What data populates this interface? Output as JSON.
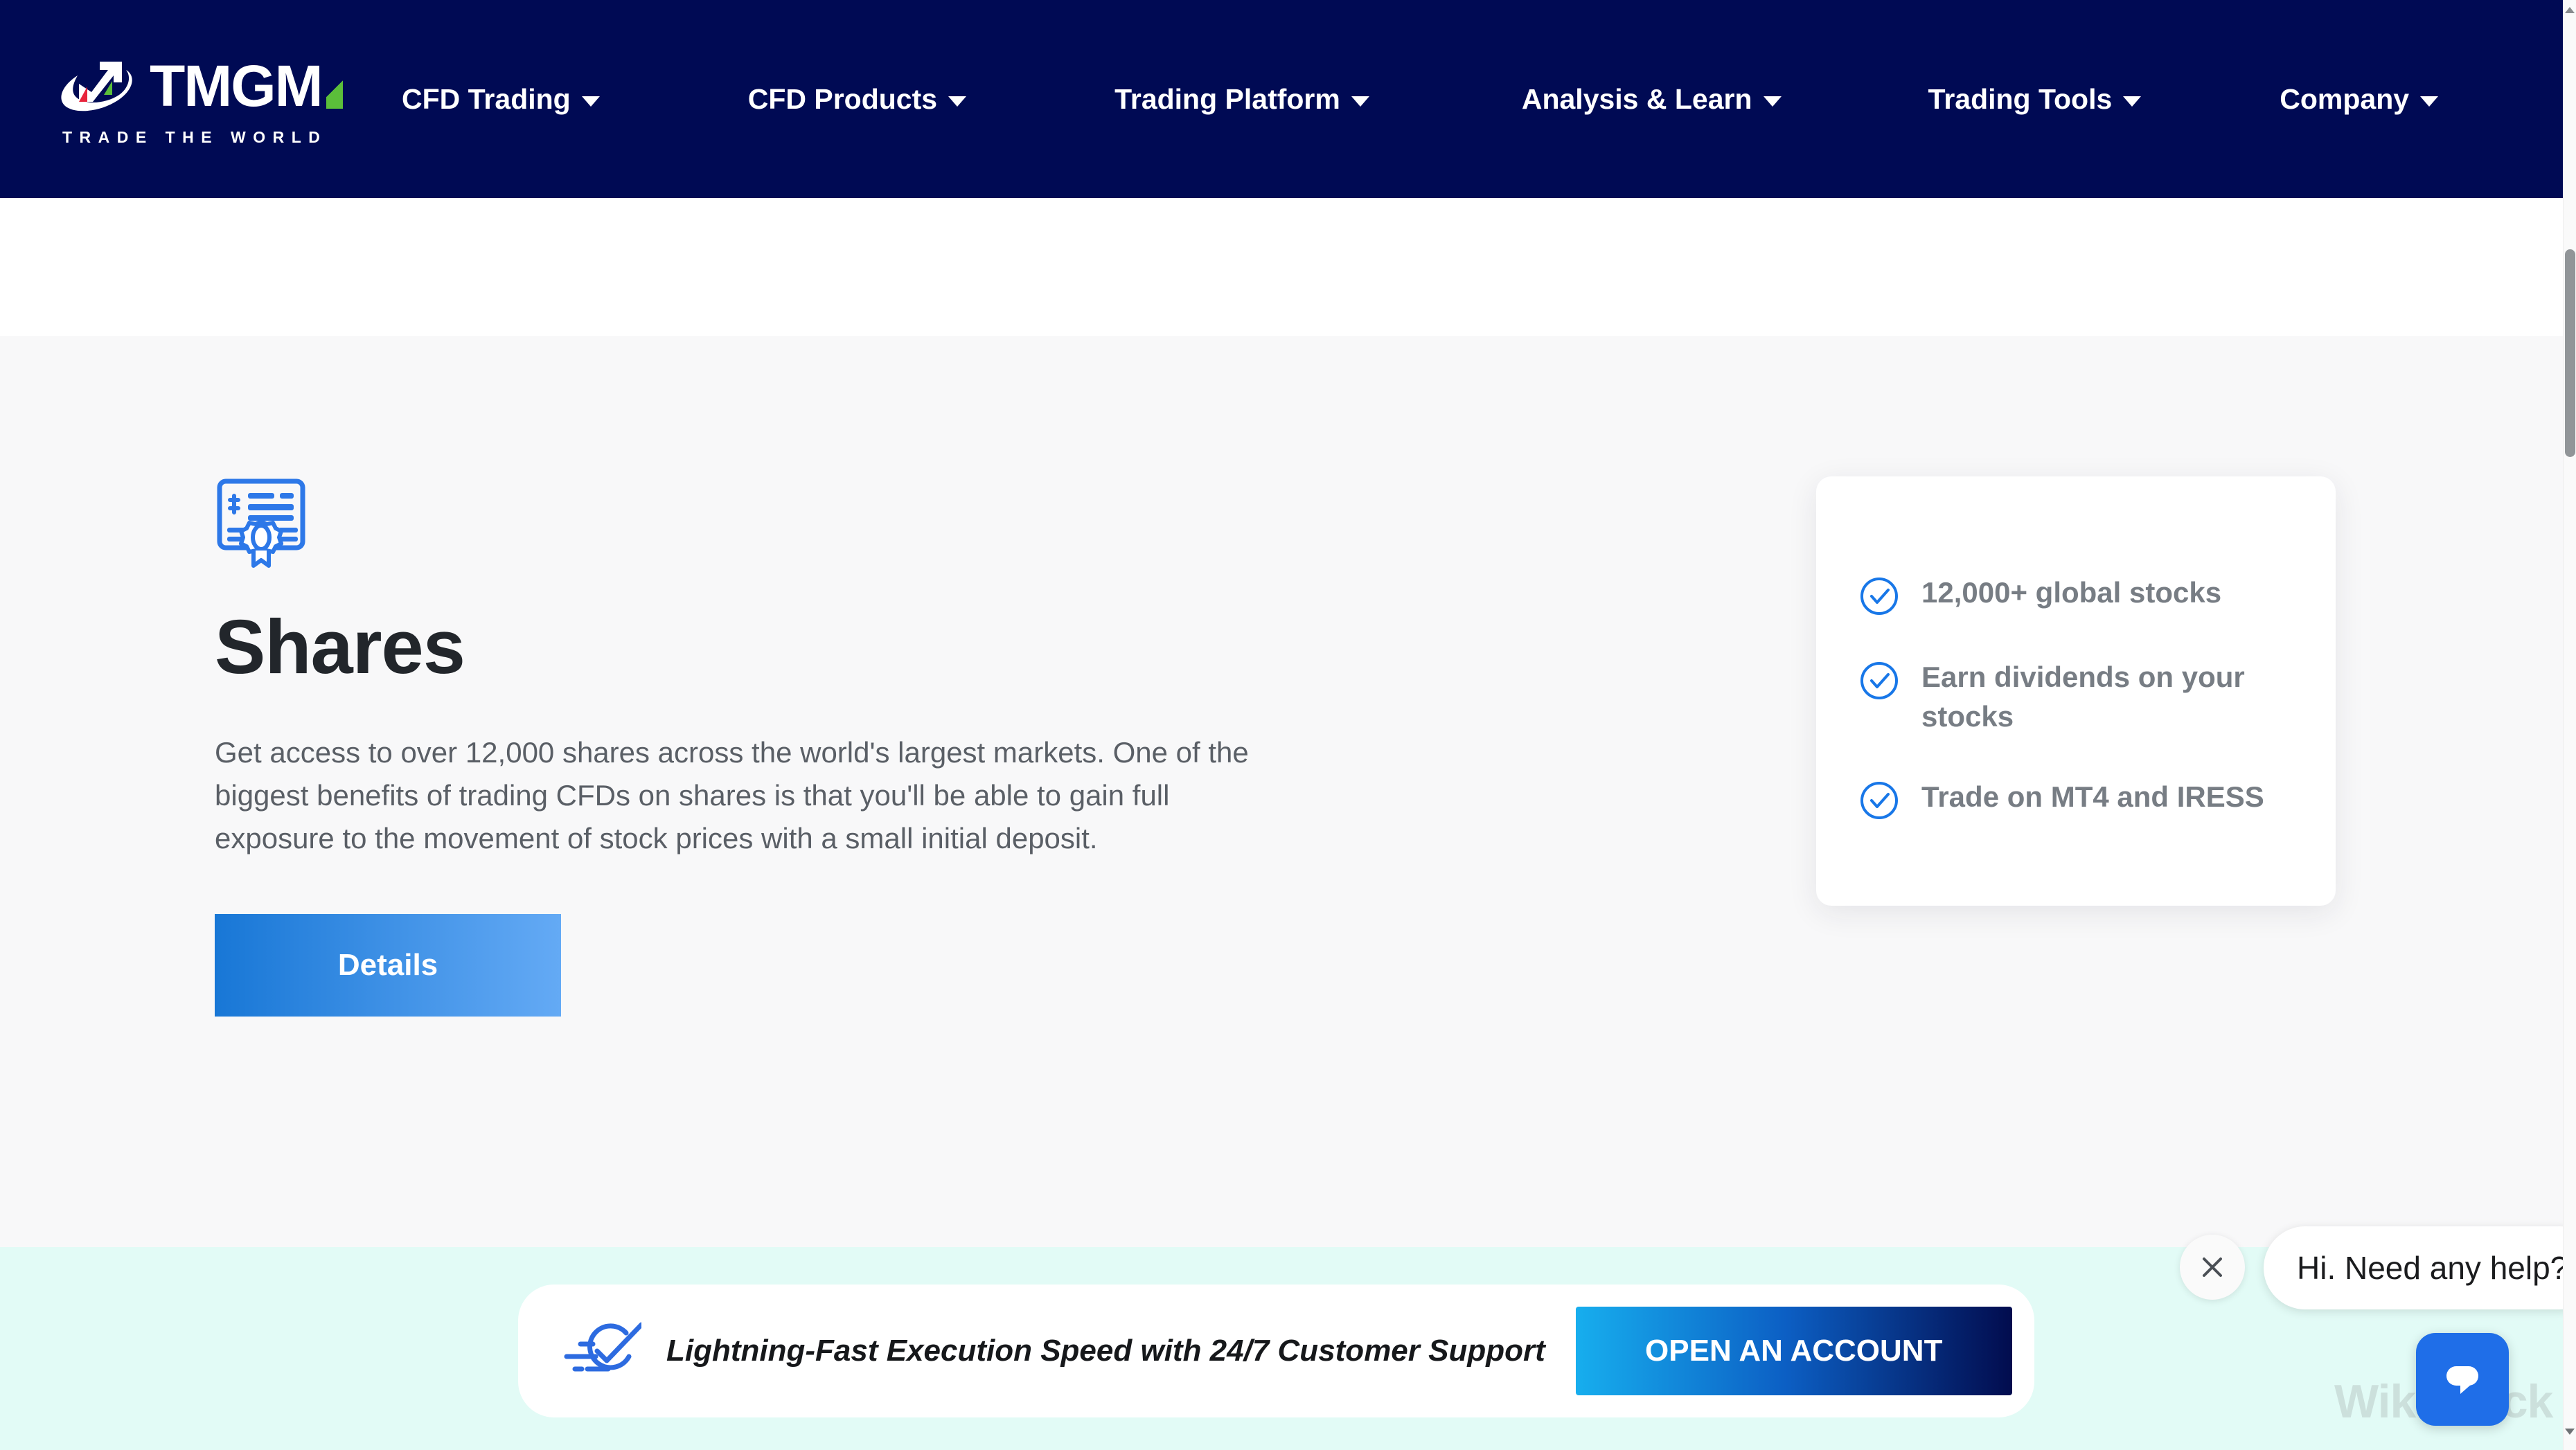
{
  "header": {
    "logo": {
      "wordmark": "TMGM",
      "tagline": "TRADE THE WORLD",
      "mark_icon": "trending-arrow-icon"
    },
    "nav_items": [
      {
        "label": "CFD Trading",
        "caret": "chevron-down-icon"
      },
      {
        "label": "CFD Products",
        "caret": "chevron-down-icon"
      },
      {
        "label": "Trading Platform",
        "caret": "chevron-down-icon"
      },
      {
        "label": "Analysis & Learn",
        "caret": "chevron-down-icon"
      },
      {
        "label": "Trading Tools",
        "caret": "chevron-down-icon"
      },
      {
        "label": "Company",
        "caret": "chevron-down-icon"
      }
    ],
    "background_color": "#000A54"
  },
  "main": {
    "icon_name": "share-certificate-icon",
    "title": "Shares",
    "description": "Get access to over 12,000 shares across the world's largest markets. One of the biggest benefits of trading CFDs on shares is that you'll be able to gain full exposure to the movement of stock prices with a small initial deposit.",
    "details_button": "Details",
    "details_gradient_from": "#1877D6",
    "details_gradient_to": "#64AAF5"
  },
  "feature_card": {
    "items": [
      {
        "text": "12,000+ global stocks",
        "icon": "check-circle-icon"
      },
      {
        "text": "Earn dividends on your stocks",
        "icon": "check-circle-icon"
      },
      {
        "text": "Trade on MT4 and IRESS",
        "icon": "check-circle-icon"
      }
    ],
    "check_color": "#1877E8",
    "text_color": "#777D84"
  },
  "promo_banner": {
    "icon_name": "fast-check-speed-icon",
    "message": "Lightning-Fast Execution Speed with 24/7 Customer Support",
    "cta_label": "OPEN AN ACCOUNT",
    "cta_gradient_from": "#17AEEE",
    "cta_gradient_to": "#020C4E",
    "section_background": "#E2FBF6"
  },
  "chat": {
    "greeting": "Hi. Need any help?",
    "close_icon": "close-icon",
    "launcher_icon": "chat-bubble-icon",
    "launcher_color": "#1F6EE8"
  },
  "watermark": {
    "text": "WikiStock"
  },
  "scrollbar": {
    "up_icon": "scroll-up-arrow-icon",
    "down_icon": "scroll-down-arrow-icon"
  }
}
